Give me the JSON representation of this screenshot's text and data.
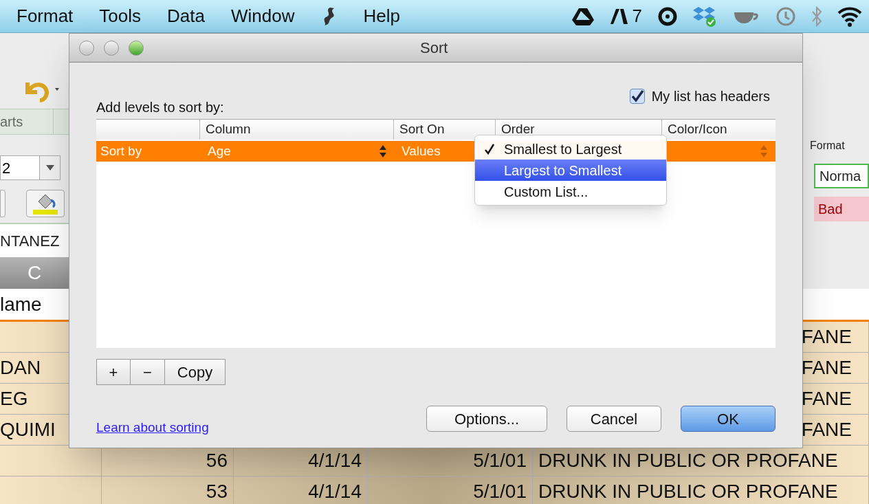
{
  "menu_bar": {
    "items": [
      {
        "kind": "text",
        "label": "Format"
      },
      {
        "kind": "text",
        "label": "Tools"
      },
      {
        "kind": "text",
        "label": "Data"
      },
      {
        "kind": "text",
        "label": "Window"
      },
      {
        "kind": "icon"
      },
      {
        "kind": "text",
        "label": "Help"
      }
    ],
    "adobe_count": "7"
  },
  "background": {
    "tab_label": "arts",
    "font_size": "2",
    "cell_value": "NTANEZ",
    "column_header": "C",
    "header_cell": "lame",
    "styles_label": "Format",
    "styles": [
      {
        "label": "Norma",
        "kind": "normal"
      },
      {
        "label": "Bad",
        "kind": "bad"
      }
    ],
    "rows": [
      {
        "charge": "FANE"
      },
      {
        "name": "DAN",
        "charge": "FANE"
      },
      {
        "name": "EG",
        "charge": "FANE"
      },
      {
        "name": "QUIMI",
        "charge": "FANE"
      },
      {
        "age": "56",
        "date_1": "4/1/14",
        "date_2": "5/1/01",
        "charge": "DRUNK IN PUBLIC OR PROFANE"
      },
      {
        "age": "53",
        "date_1": "4/1/14",
        "date_2": "5/1/01",
        "charge": "DRUNK IN PUBLIC OR PROFANE"
      }
    ]
  },
  "dialog": {
    "title": "Sort",
    "prompt": "Add levels to sort by:",
    "headers_checkbox": {
      "label": "My list has headers",
      "checked": true
    },
    "columns": [
      "Column",
      "Sort On",
      "Order",
      "Color/Icon"
    ],
    "levels": [
      {
        "label": "Sort by",
        "column": "Age",
        "sort_on": "Values",
        "selected": true
      }
    ],
    "order_menu": [
      {
        "label": "Smallest to Largest",
        "checked": true,
        "highlighted": false
      },
      {
        "label": "Largest to Smallest",
        "checked": false,
        "highlighted": true
      },
      {
        "label": "Custom List...",
        "checked": false,
        "highlighted": false
      }
    ],
    "level_buttons": [
      "+",
      "−",
      "Copy"
    ],
    "link": "Learn about sorting",
    "buttons": [
      {
        "label": "Options...",
        "default": false
      },
      {
        "label": "Cancel",
        "default": false
      },
      {
        "label": "OK",
        "default": true
      }
    ]
  }
}
